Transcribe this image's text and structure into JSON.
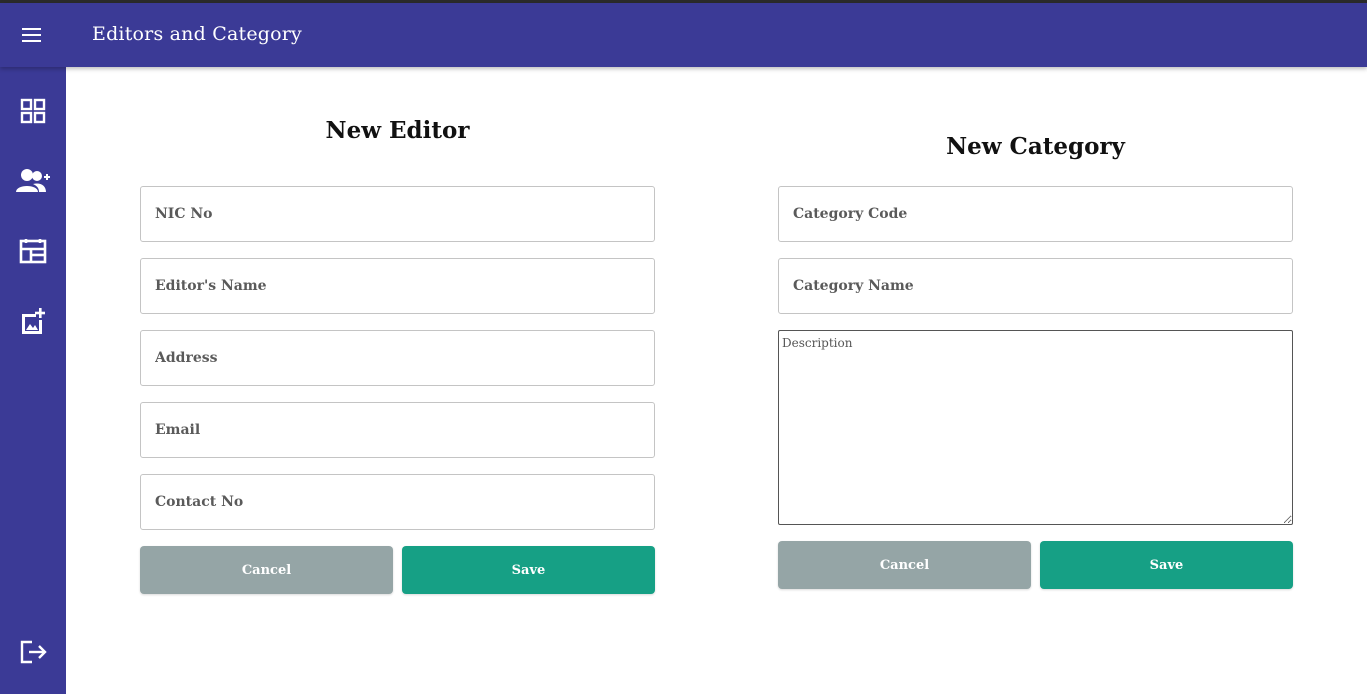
{
  "app": {
    "title": "Editors and Category",
    "bar_color": "#3b3a96"
  },
  "sidebar": {
    "items": [
      {
        "icon": "dashboard-icon"
      },
      {
        "icon": "add-user-icon"
      },
      {
        "icon": "calendar-table-icon"
      },
      {
        "icon": "add-image-icon"
      }
    ],
    "logout_icon": "logout-icon"
  },
  "editor_form": {
    "title": "New Editor",
    "fields": {
      "nic": {
        "placeholder": "NIC No",
        "value": ""
      },
      "name": {
        "placeholder": "Editor's Name",
        "value": ""
      },
      "address": {
        "placeholder": "Address",
        "value": ""
      },
      "email": {
        "placeholder": "Email",
        "value": ""
      },
      "contact": {
        "placeholder": "Contact No",
        "value": ""
      }
    },
    "cancel_label": "Cancel",
    "save_label": "Save"
  },
  "category_form": {
    "title": "New Category",
    "fields": {
      "code": {
        "placeholder": "Category Code",
        "value": ""
      },
      "name": {
        "placeholder": "Category Name",
        "value": ""
      },
      "description": {
        "placeholder": "Description",
        "value": ""
      }
    },
    "cancel_label": "Cancel",
    "save_label": "Save"
  },
  "colors": {
    "cancel": "#95a5a6",
    "save": "#16a085"
  }
}
